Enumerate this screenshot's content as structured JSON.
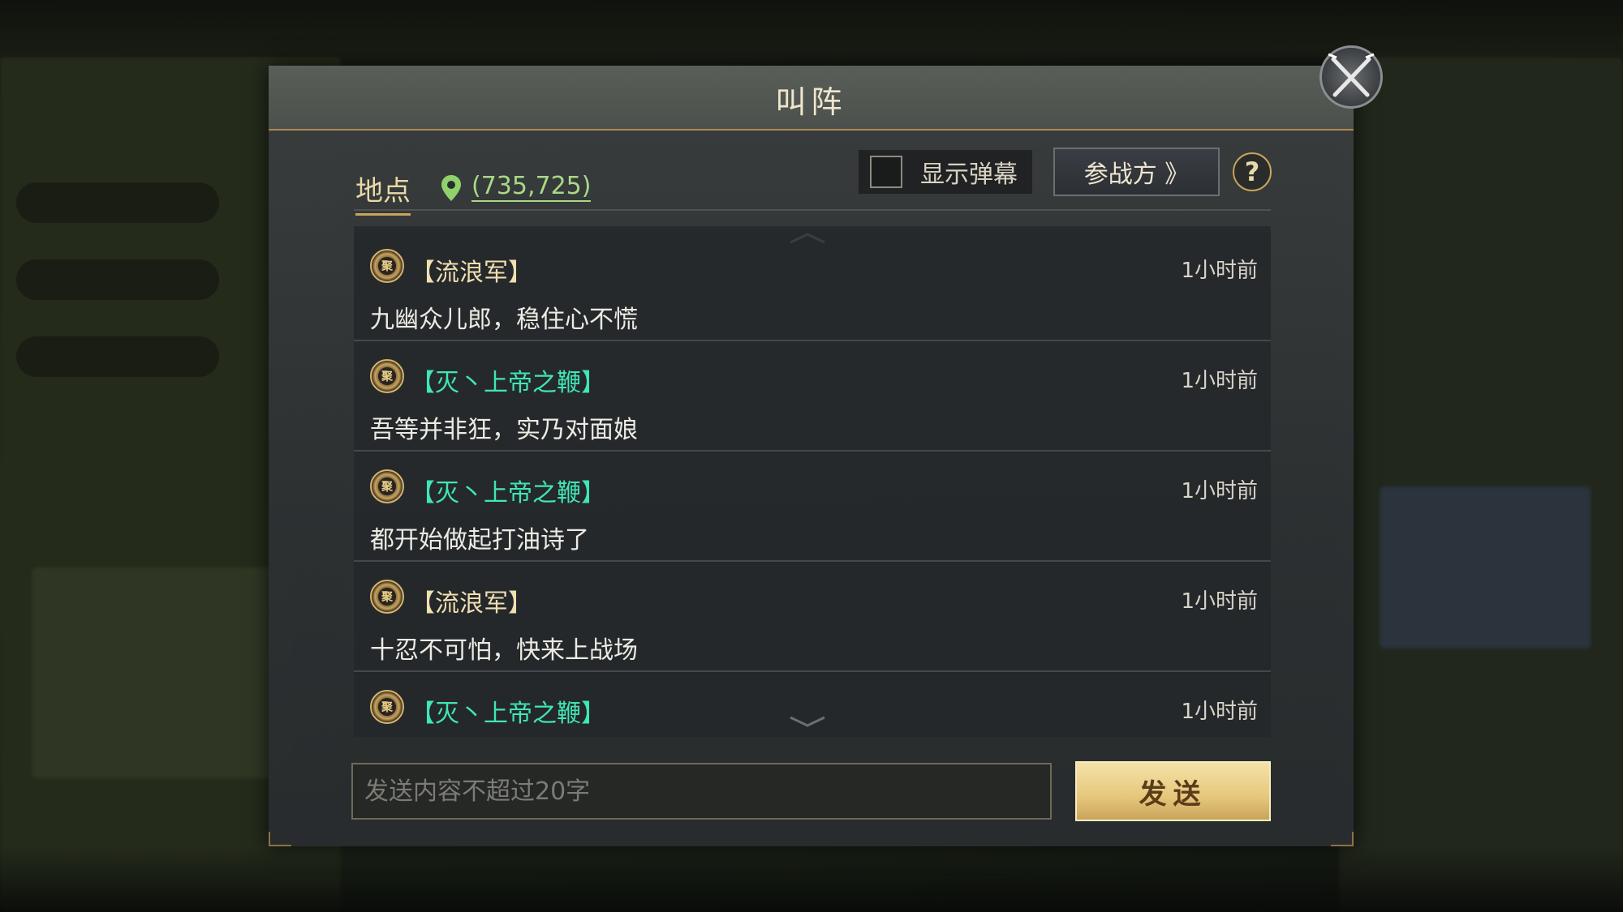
{
  "dialog": {
    "title": "叫阵",
    "location_label": "地点",
    "coordinates": "(735,725)",
    "danmu_label": "显示弹幕",
    "danmu_checked": false,
    "participants_button": "参战方 》",
    "help_label": "?"
  },
  "messages": [
    {
      "sender": "【流浪军】",
      "sender_color": "#f0dfb0",
      "time": "1小时前",
      "text": "九幽众儿郎，稳住心不慌"
    },
    {
      "sender": "【灭丶上帝之鞭】",
      "sender_color": "#3fe6b8",
      "time": "1小时前",
      "text": "吾等并非狂，实乃对面娘"
    },
    {
      "sender": "【灭丶上帝之鞭】",
      "sender_color": "#3fe6b8",
      "time": "1小时前",
      "text": "都开始做起打油诗了"
    },
    {
      "sender": "【流浪军】",
      "sender_color": "#f0dfb0",
      "time": "1小时前",
      "text": "十忍不可怕，快来上战场"
    },
    {
      "sender": "【灭丶上帝之鞭】",
      "sender_color": "#3fe6b8",
      "time": "1小时前",
      "text": ""
    }
  ],
  "composer": {
    "placeholder": "发送内容不超过20字",
    "send_label": "发送"
  },
  "icons": {
    "badge_glyph": "聚",
    "close": "crossed-swords-close-icon",
    "location": "map-pin-icon"
  },
  "colors": {
    "accent_gold": "#c9a45a",
    "coord_green": "#a8d886",
    "enemy_cyan": "#3fe6b8"
  }
}
